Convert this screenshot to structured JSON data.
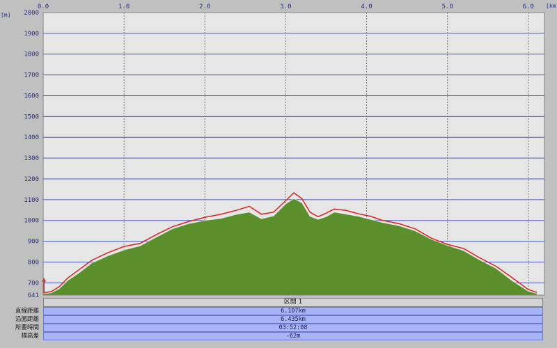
{
  "chart_data": {
    "type": "area",
    "x_unit": "[km]",
    "y_unit": "[m]",
    "xlim": [
      0,
      6.107
    ],
    "ylim": [
      641,
      2000
    ],
    "x_ticks": [
      "0.0",
      "1.0",
      "2.0",
      "3.0",
      "4.0",
      "5.0",
      "6.0"
    ],
    "y_ticks": [
      "2000",
      "1900",
      "1800",
      "1700",
      "1600",
      "1500",
      "1400",
      "1300",
      "1200",
      "1100",
      "1000",
      "900",
      "800",
      "700",
      "641"
    ],
    "grid": true,
    "series": [
      {
        "color": "#5a8f2c",
        "x": [
          0,
          0.1,
          0.2,
          0.3,
          0.45,
          0.6,
          0.8,
          1.0,
          1.2,
          1.4,
          1.6,
          1.8,
          2.0,
          2.2,
          2.4,
          2.55,
          2.7,
          2.85,
          3.0,
          3.1,
          3.2,
          3.3,
          3.4,
          3.5,
          3.6,
          3.75,
          3.9,
          4.05,
          4.2,
          4.4,
          4.6,
          4.8,
          5.0,
          5.2,
          5.4,
          5.6,
          5.8,
          6.0,
          6.107
        ],
        "y": [
          648,
          652,
          672,
          710,
          750,
          795,
          830,
          858,
          878,
          920,
          960,
          985,
          1000,
          1010,
          1030,
          1040,
          1008,
          1022,
          1080,
          1105,
          1085,
          1020,
          1005,
          1018,
          1040,
          1030,
          1020,
          1005,
          990,
          975,
          950,
          910,
          880,
          855,
          810,
          770,
          710,
          660,
          649
        ]
      },
      {
        "color": "#e02020",
        "x": [
          0,
          0.1,
          0.2,
          0.3,
          0.45,
          0.6,
          0.8,
          1.0,
          1.2,
          1.4,
          1.6,
          1.8,
          2.0,
          2.2,
          2.4,
          2.55,
          2.7,
          2.85,
          3.0,
          3.1,
          3.2,
          3.3,
          3.4,
          3.5,
          3.6,
          3.75,
          3.9,
          4.05,
          4.2,
          4.4,
          4.6,
          4.8,
          5.0,
          5.2,
          5.4,
          5.6,
          5.8,
          6.0,
          6.107
        ],
        "y": [
          652,
          658,
          682,
          722,
          765,
          808,
          845,
          875,
          890,
          932,
          970,
          995,
          1015,
          1030,
          1050,
          1068,
          1030,
          1040,
          1095,
          1133,
          1105,
          1040,
          1018,
          1035,
          1055,
          1048,
          1032,
          1020,
          1000,
          985,
          960,
          915,
          885,
          865,
          820,
          780,
          725,
          668,
          654
        ]
      }
    ]
  },
  "info": {
    "section_header": "区間 1",
    "rows": [
      {
        "label": "直線距離",
        "value": "6.107km"
      },
      {
        "label": "沿面距離",
        "value": "6.435km"
      },
      {
        "label": "所要時間",
        "value": "03:52:08"
      },
      {
        "label": "標高差",
        "value": "-62m"
      }
    ]
  },
  "colors": {
    "plot_bg": "#e6e6e6",
    "grid_h": "#4a5ac8",
    "grid_v": "#7a7a7a",
    "marker": "#e02020"
  }
}
